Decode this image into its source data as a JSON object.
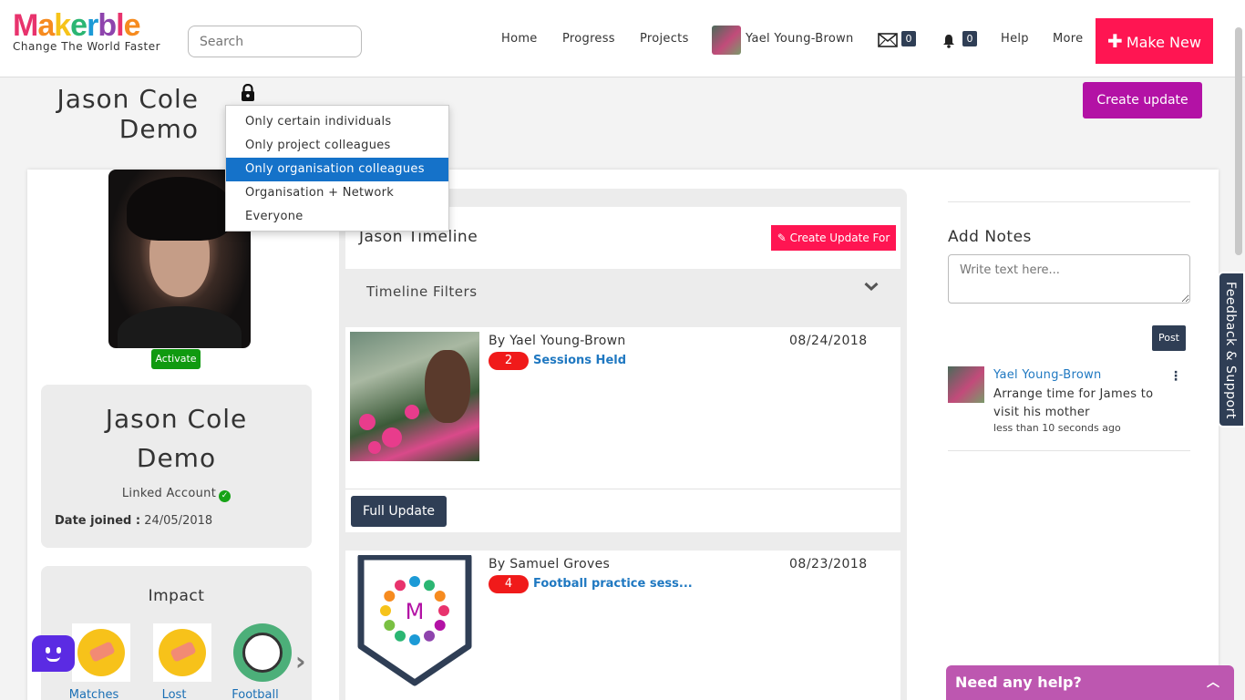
{
  "brand": {
    "logo_letters": [
      "M",
      "a",
      "k",
      "e",
      "r",
      "b",
      "l",
      "e"
    ],
    "logo_colors": [
      "#e8336d",
      "#f68b1f",
      "#f6c31a",
      "#2bb673",
      "#1c9ad6",
      "#8e44ad",
      "#e8336d",
      "#f68b1f"
    ],
    "tagline": "Change The World Faster"
  },
  "search": {
    "placeholder": "Search"
  },
  "nav": {
    "home": "Home",
    "progress": "Progress",
    "projects": "Projects",
    "user_name": "Yael Young-Brown",
    "mail_count": "0",
    "notif_count": "0",
    "help": "Help",
    "more": "More",
    "make_new": "Make New"
  },
  "header": {
    "title_line1": "Jason Cole",
    "title_line2": "Demo",
    "create_update": "Create update"
  },
  "privacy_menu": {
    "items": [
      "Only certain individuals",
      "Only project colleagues",
      "Only organisation colleagues",
      "Organisation + Network",
      "Everyone"
    ],
    "selected": "Only organisation colleagues"
  },
  "profile": {
    "activate": "Activate",
    "name_line1": "Jason Cole",
    "name_line2": "Demo",
    "linked_account": "Linked Account",
    "date_joined_label": "Date joined :",
    "date_joined": "24/05/2018"
  },
  "impact": {
    "title": "Impact",
    "items": [
      "Matches",
      "Lost",
      "Football"
    ]
  },
  "timeline": {
    "title": "Jason Timeline",
    "create_update_for": "Create Update For",
    "filters_label": "Timeline Filters",
    "posts": [
      {
        "author": "By Yael Young-Brown",
        "date": "08/24/2018",
        "count": "2",
        "link": "Sessions Held",
        "full_update": "Full Update"
      },
      {
        "author": "By Samuel Groves",
        "date": "08/23/2018",
        "count": "4",
        "link": "Football practice sess..."
      }
    ]
  },
  "notes": {
    "title": "Add Notes",
    "placeholder": "Write text here...",
    "post": "Post",
    "entries": [
      {
        "author": "Yael Young-Brown",
        "text": "Arrange time for James to visit his mother",
        "time": "less than 10 seconds ago"
      }
    ]
  },
  "feedback": "Feedback & Support",
  "help_widget": "Need any help?",
  "colors": {
    "accent_red": "#ff1552",
    "accent_purple": "#b312a5",
    "navy": "#2f3e55",
    "link_blue": "#1f78c1",
    "menu_highlight": "#1572c9"
  }
}
